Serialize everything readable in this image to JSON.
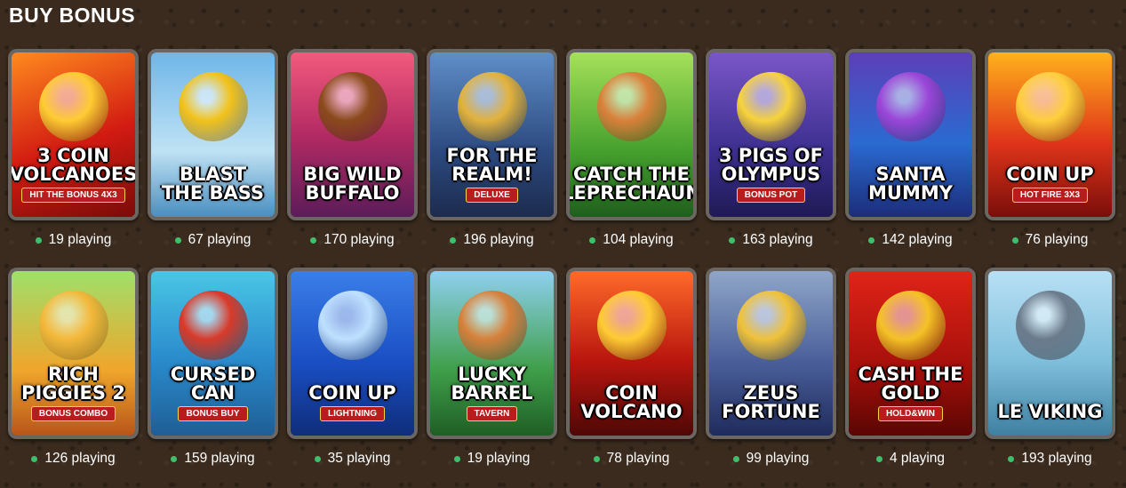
{
  "section": {
    "title": "BUY BONUS"
  },
  "status_color": "#3fbf6a",
  "rows": [
    [
      {
        "name": "3 COIN VOLCANOES",
        "sub": "HIT the BONUS 4x3",
        "players": "19 playing",
        "bg": "linear-gradient(160deg,#ff8a1e,#d21b12 55%,#7a0b08)",
        "deco": "#ffcc33",
        "icon": "volcano-icon"
      },
      {
        "name": "BLAST THE BASS",
        "sub": "",
        "players": "67 playing",
        "bg": "linear-gradient(180deg,#6fb6e8,#bfe2f5 60%,#4a8ec0)",
        "deco": "#f2c21b",
        "icon": "fisherman-icon"
      },
      {
        "name": "BIG WILD BUFFALO",
        "sub": "",
        "players": "170 playing",
        "bg": "linear-gradient(180deg,#f25a7d,#b32a63 50%,#5c1c59)",
        "deco": "#8a4a1c",
        "icon": "buffalo-icon"
      },
      {
        "name": "FOR THE REALM!",
        "sub": "DELUXE",
        "players": "196 playing",
        "bg": "linear-gradient(180deg,#5f8ec8,#2c4a80 60%,#1d2b4e)",
        "deco": "#e3b23c",
        "icon": "crest-icon"
      },
      {
        "name": "CATCH THE LEPRECHAUN",
        "sub": "",
        "players": "104 playing",
        "bg": "linear-gradient(180deg,#a6e05a,#45a12d 60%,#1f5e1d)",
        "deco": "#d9803a",
        "icon": "leprechaun-icon"
      },
      {
        "name": "3 PIGS OF OLYMPUS",
        "sub": "BONUS POT",
        "players": "163 playing",
        "bg": "linear-gradient(180deg,#7a56c8,#3c2f8f 60%,#1f1a55)",
        "deco": "#f7d33c",
        "icon": "pig-icon"
      },
      {
        "name": "SANTA MUMMY",
        "sub": "",
        "players": "142 playing",
        "bg": "linear-gradient(180deg,#5c3fb8,#2a6ad1 55%,#1c2d7a)",
        "deco": "#9a46d8",
        "icon": "mummy-icon"
      },
      {
        "name": "COIN UP",
        "sub": "HOT FIRE 3X3",
        "players": "76 playing",
        "bg": "linear-gradient(180deg,#ffb21c,#e0341a 55%,#7a0e0a)",
        "deco": "#ffcf3d",
        "icon": "coin-icon"
      }
    ],
    [
      {
        "name": "RICH PIGGIES 2",
        "sub": "BONUS COMBO",
        "players": "126 playing",
        "bg": "linear-gradient(180deg,#9fe06a,#f0a62b 60%,#b8551a)",
        "deco": "#f3b83a",
        "icon": "piggy-icon"
      },
      {
        "name": "CURSED CAN",
        "sub": "BONUS BUY",
        "players": "159 playing",
        "bg": "linear-gradient(180deg,#4ac6e6,#2a8acb 55%,#1f5e96)",
        "deco": "#d83a2a",
        "icon": "watering-can-icon"
      },
      {
        "name": "COIN UP",
        "sub": "LIGHTNING",
        "players": "35 playing",
        "bg": "linear-gradient(180deg,#3b7ee8,#1a4fc4 55%,#0f2d7a)",
        "deco": "#bfe1ff",
        "icon": "coin-icon"
      },
      {
        "name": "LUCKY BARREL",
        "sub": "TAVERN",
        "players": "19 playing",
        "bg": "linear-gradient(180deg,#8fd0f0,#3f9f4a 60%,#1f5e25)",
        "deco": "#d6803a",
        "icon": "barrel-icon"
      },
      {
        "name": "COIN VOLCANO",
        "sub": "",
        "players": "78 playing",
        "bg": "linear-gradient(180deg,#ff6a2a,#b8150e 55%,#4e0806)",
        "deco": "#ffcc33",
        "icon": "volcano-icon"
      },
      {
        "name": "ZEUS FORTUNE",
        "sub": "",
        "players": "99 playing",
        "bg": "linear-gradient(180deg,#8fa6c8,#4a5f9a 55%,#1f2b5c)",
        "deco": "#f0c23a",
        "icon": "zeus-icon"
      },
      {
        "name": "CASH THE GOLD",
        "sub": "HOLD&WIN",
        "players": "4 playing",
        "bg": "linear-gradient(180deg,#e02418,#a50f0a 60%,#5a0604)",
        "deco": "#f5c226",
        "icon": "gold-coin-icon"
      },
      {
        "name": "LE VIKING",
        "sub": "",
        "players": "193 playing",
        "bg": "linear-gradient(180deg,#b8e0f5,#7fbfdc 55%,#3f7fa0)",
        "deco": "#6b7b8c",
        "icon": "viking-icon"
      }
    ]
  ]
}
